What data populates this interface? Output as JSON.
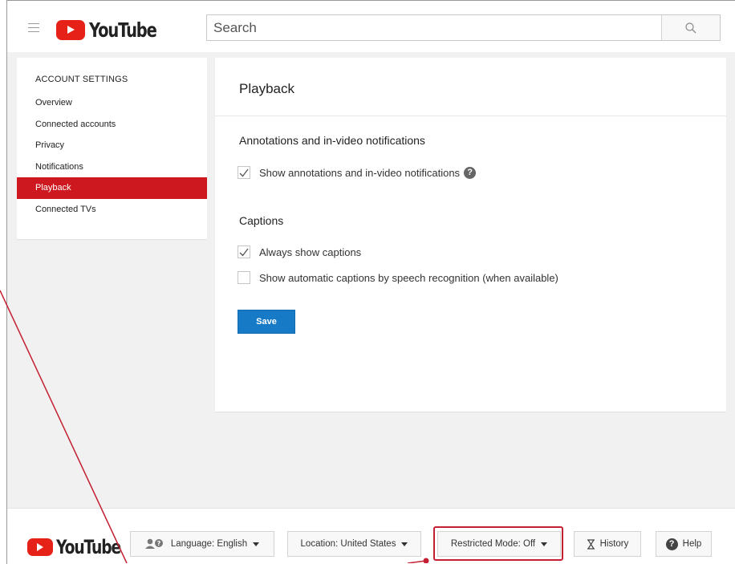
{
  "header": {
    "logo_text": "YouTube",
    "search_placeholder": "Search"
  },
  "sidebar": {
    "heading": "ACCOUNT SETTINGS",
    "items": [
      {
        "label": "Overview",
        "active": false
      },
      {
        "label": "Connected accounts",
        "active": false
      },
      {
        "label": "Privacy",
        "active": false
      },
      {
        "label": "Notifications",
        "active": false
      },
      {
        "label": "Playback",
        "active": true
      },
      {
        "label": "Connected TVs",
        "active": false
      }
    ]
  },
  "main": {
    "title": "Playback",
    "annotations": {
      "heading": "Annotations and in-video notifications",
      "option_label": "Show annotations and in-video notifications",
      "checked": true
    },
    "captions": {
      "heading": "Captions",
      "options": [
        {
          "label": "Always show captions",
          "checked": true
        },
        {
          "label": "Show automatic captions by speech recognition (when available)",
          "checked": false
        }
      ]
    },
    "save_label": "Save"
  },
  "footer": {
    "logo_text": "YouTube",
    "language_label": "Language: English",
    "location_label": "Location: United States",
    "restricted_label": "Restricted Mode: Off",
    "history_label": "History",
    "help_label": "Help"
  },
  "colors": {
    "brand_red": "#e62117",
    "active_nav": "#cc181e",
    "primary_blue": "#167ac6",
    "annotation_red": "#c41f32"
  }
}
